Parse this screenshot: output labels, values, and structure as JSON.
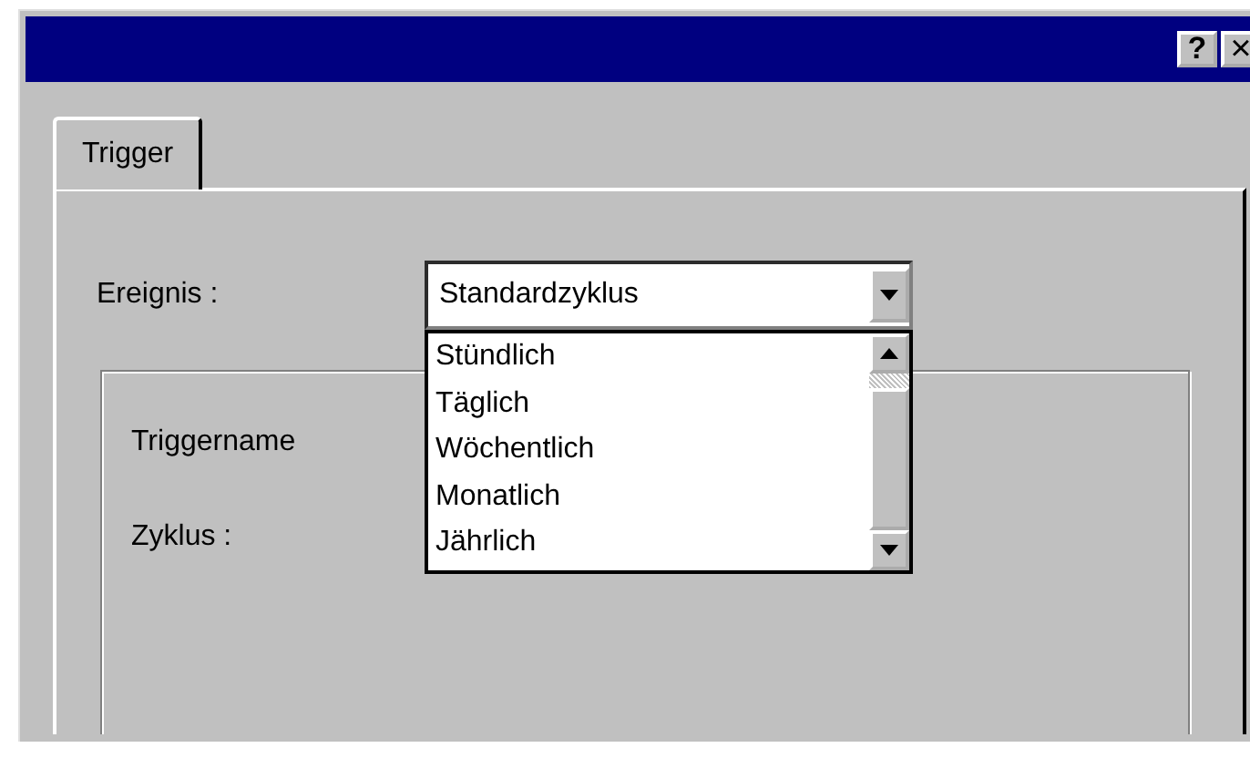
{
  "title_bar": {
    "buttons": [
      {
        "label": "?",
        "kind": "help"
      },
      {
        "label": "×",
        "kind": "close"
      }
    ]
  },
  "tabs": [
    {
      "label": "Trigger",
      "selected": true
    }
  ],
  "event": {
    "label": "Ereignis :",
    "value": "Standardzyklus",
    "expanded": true,
    "options": [
      {
        "label": "Stündlich",
        "selected": false
      },
      {
        "label": "Täglich",
        "selected": false
      },
      {
        "label": "Wöchentlich",
        "selected": false
      },
      {
        "label": "Monatlich",
        "selected": false
      },
      {
        "label": "Jährlich",
        "selected": false
      }
    ]
  },
  "group": {
    "fields": [
      {
        "label": "Triggername"
      },
      {
        "label": "Zyklus :"
      }
    ]
  }
}
